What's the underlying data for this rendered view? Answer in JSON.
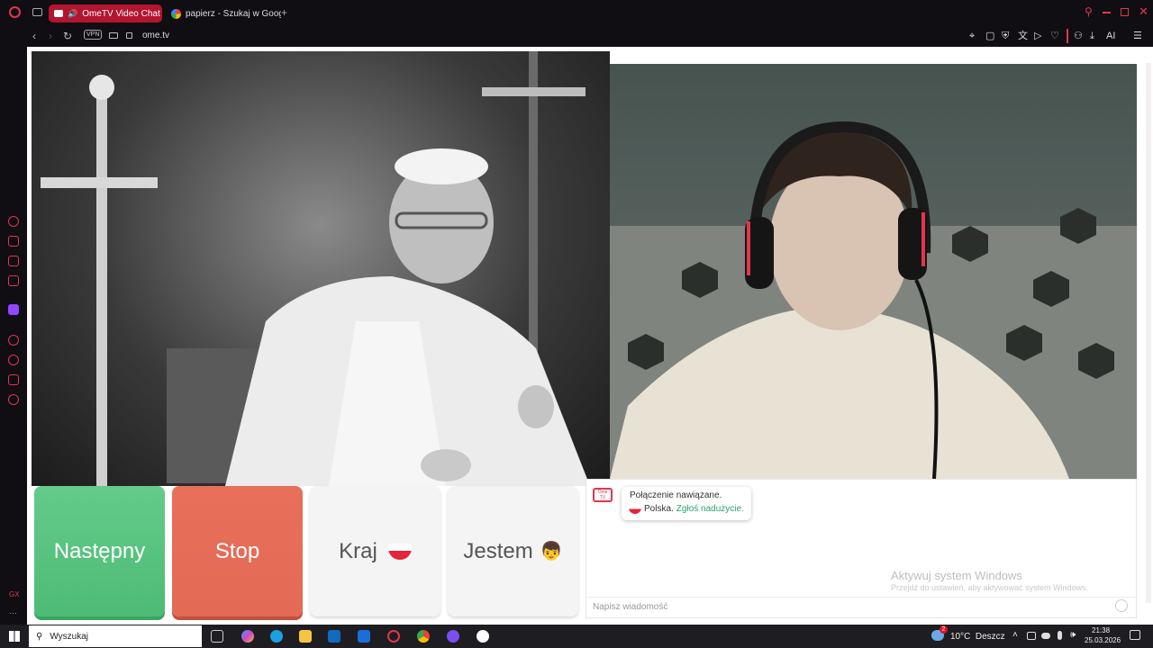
{
  "browser": {
    "tabs": [
      {
        "label": "OmeTV Video Chat —",
        "active": true
      },
      {
        "label": "papierz - Szukaj w Google",
        "active": false
      }
    ],
    "url": "ome.tv",
    "vpn_label": "VPN",
    "ai_label": "AI"
  },
  "controls": {
    "next_label": "Następny",
    "stop_label": "Stop",
    "country_label": "Kraj",
    "gender_label": "Jestem",
    "gender_emoji": "👦"
  },
  "chat": {
    "logo_label": "Ome TV",
    "status_text": "Połączenie nawiązane.",
    "country_text": "Polska.",
    "report_link": "Zgłoś nadużycie.",
    "input_placeholder": "Napisz wiadomość"
  },
  "watermark": {
    "title": "Aktywuj system Windows",
    "subtitle": "Przejdź do ustawień, aby aktywować system Windows."
  },
  "taskbar": {
    "search_placeholder": "Wyszukaj",
    "weather": "10°C  Deszcz",
    "weather_badge": "2",
    "time": "21:38",
    "date": "25.03.2026"
  },
  "colors": {
    "next": "#5cc27f",
    "stop": "#e3664f",
    "accent": "#e2364e"
  }
}
